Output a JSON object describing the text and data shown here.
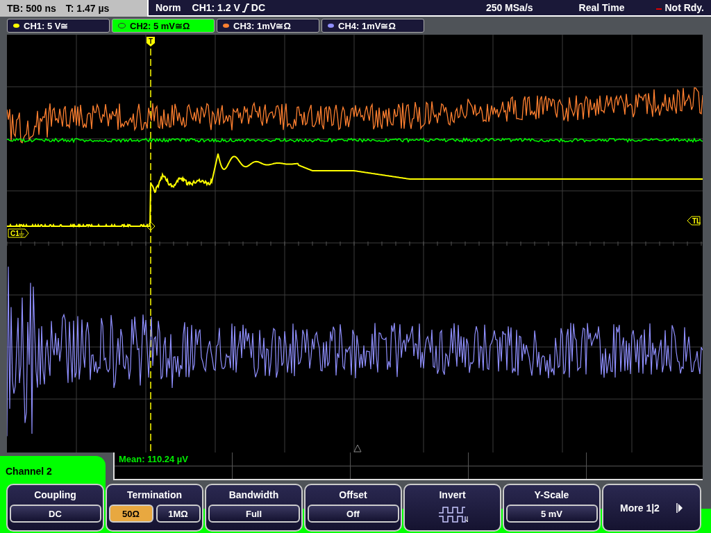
{
  "top_bar": {
    "timebase": "TB: 500 ns",
    "trigger_time": "T: 1.47 µs",
    "mode": "Norm",
    "trigger_level": "CH1: 1.2 V",
    "trigger_coupling": "DC",
    "sample_rate": "250 MSa/s",
    "acquisition": "Real Time",
    "status": "Not Rdy."
  },
  "channels": [
    {
      "label": "CH1: 5 V≅",
      "color": "#ffff00",
      "selected": false
    },
    {
      "label": "CH2: 5 mV≅Ω",
      "color": "#00ff00",
      "selected": true
    },
    {
      "label": "CH3: 1mV≅Ω",
      "color": "#ff8030",
      "selected": false
    },
    {
      "label": "CH4: 1mV≅Ω",
      "color": "#9090ff",
      "selected": false
    }
  ],
  "markers": {
    "trigger": "T",
    "ch1_label": "C1",
    "trigger_level": "TL"
  },
  "measurement": "Mean: 110.24 µV",
  "panel_title": "Channel 2",
  "softkeys": [
    {
      "kind": "value",
      "title": "Coupling",
      "value": "DC"
    },
    {
      "kind": "toggle",
      "title": "Termination",
      "options": [
        {
          "label": "50Ω",
          "selected": true
        },
        {
          "label": "1MΩ",
          "selected": false
        }
      ]
    },
    {
      "kind": "value",
      "title": "Bandwidth",
      "value": "Full"
    },
    {
      "kind": "value",
      "title": "Offset",
      "value": "Off"
    },
    {
      "kind": "icon",
      "title": "Invert"
    },
    {
      "kind": "value",
      "title": "Y-Scale",
      "value": "5 mV"
    },
    {
      "kind": "more",
      "title": "More 1|2"
    }
  ]
}
